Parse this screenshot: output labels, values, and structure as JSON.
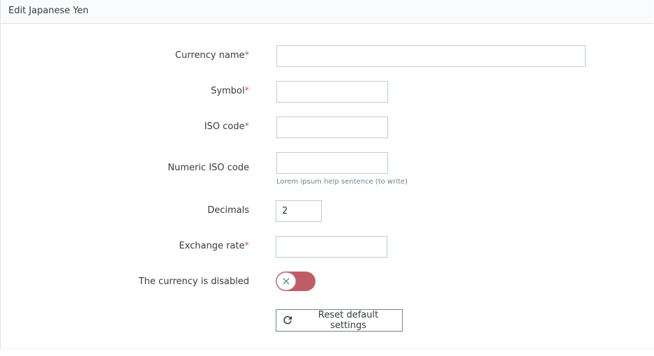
{
  "header": {
    "title": "Edit Japanese Yen"
  },
  "form": {
    "currency_name": {
      "label": "Currency name",
      "required": "*",
      "value": ""
    },
    "symbol": {
      "label": "Symbol",
      "required": "*",
      "value": ""
    },
    "iso_code": {
      "label": "ISO code",
      "required": "*",
      "value": ""
    },
    "numeric_iso_code": {
      "label": "Numeric ISO code",
      "value": "",
      "help": "Lorem ipsum help sentence (to write)"
    },
    "decimals": {
      "label": "Decimals",
      "value": "2"
    },
    "exchange_rate": {
      "label": "Exchange rate",
      "required": "*",
      "value": ""
    },
    "disabled": {
      "label": "The currency is disabled",
      "state": "off",
      "icon": "close-icon",
      "glyph": "×"
    },
    "reset_button": {
      "label": "Reset default settings",
      "icon": "refresh-icon"
    }
  },
  "colors": {
    "required": "#c05c67",
    "switch_off": "#c05c67",
    "border": "#bbcdd2",
    "help_text": "#6c868e"
  }
}
